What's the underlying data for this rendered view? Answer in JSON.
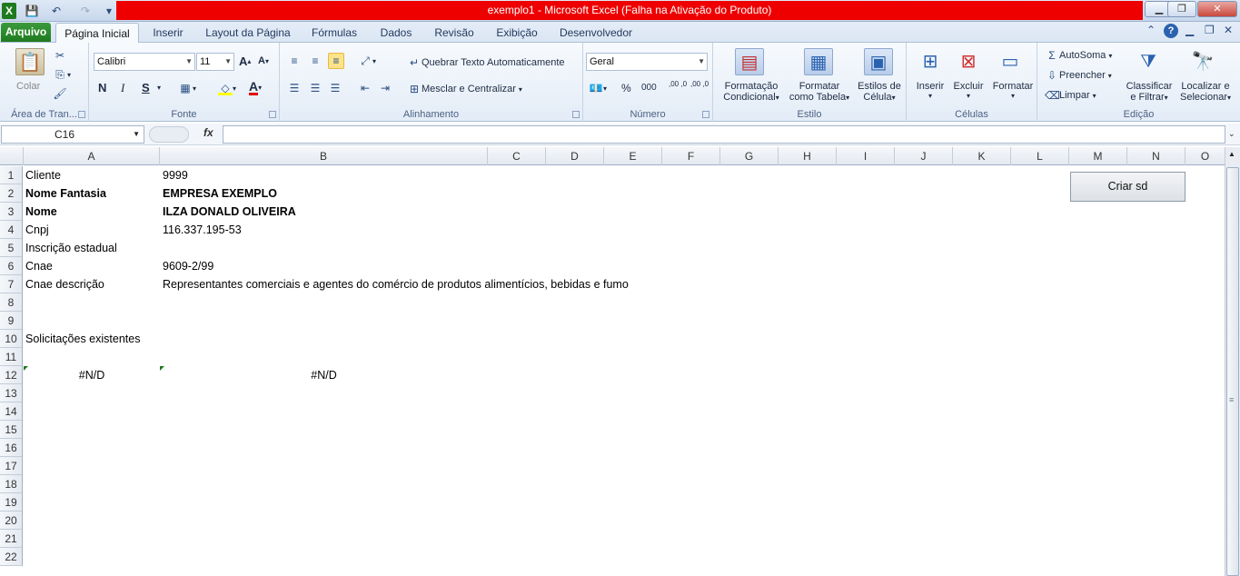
{
  "window": {
    "title": "exemplo1  -  Microsoft Excel (Falha na Ativação do Produto)",
    "minimize": "▁",
    "restore": "❐",
    "close": "✕"
  },
  "qat": {
    "app_icon": "X",
    "save": "💾",
    "undo": "↶",
    "redo": "↷",
    "customize": "▾"
  },
  "tabs": [
    "Arquivo",
    "Página Inicial",
    "Inserir",
    "Layout da Página",
    "Fórmulas",
    "Dados",
    "Revisão",
    "Exibição",
    "Desenvolvedor"
  ],
  "ribbon": {
    "clipboard": {
      "label": "Área de Tran...",
      "paste": "Colar"
    },
    "font": {
      "label": "Fonte",
      "family": "Calibri",
      "size": "11",
      "bold": "N",
      "italic": "I",
      "underline": "S"
    },
    "alignment": {
      "label": "Alinhamento",
      "wrap": "Quebrar Texto Automaticamente",
      "merge": "Mesclar e Centralizar"
    },
    "number": {
      "label": "Número",
      "format": "Geral",
      "percent": "%",
      "thousands": "000",
      "inc_dec": ",00 ,0",
      "dec_dec": ",00 ,0"
    },
    "styles": {
      "label": "Estilo",
      "conditional": [
        "Formatação",
        "Condicional"
      ],
      "table": [
        "Formatar",
        "como Tabela"
      ],
      "cell": [
        "Estilos de",
        "Célula"
      ]
    },
    "cells": {
      "label": "Células",
      "insert": "Inserir",
      "delete": "Excluir",
      "format": "Formatar"
    },
    "editing": {
      "label": "Edição",
      "autosum": "AutoSoma",
      "fill": "Preencher",
      "clear": "Limpar",
      "sort": [
        "Classificar",
        "e Filtrar"
      ],
      "find": [
        "Localizar e",
        "Selecionar"
      ]
    }
  },
  "formula_bar": {
    "name_box": "C16",
    "fx": "fx",
    "value": ""
  },
  "columns": [
    "A",
    "B",
    "C",
    "D",
    "E",
    "F",
    "G",
    "H",
    "I",
    "J",
    "K",
    "L",
    "M",
    "N",
    "O"
  ],
  "rows": [
    "1",
    "2",
    "3",
    "4",
    "5",
    "6",
    "7",
    "8",
    "9",
    "10",
    "11",
    "12",
    "13",
    "14",
    "15",
    "16",
    "17",
    "18",
    "19",
    "20",
    "21",
    "22"
  ],
  "cells": {
    "A1": "Cliente",
    "B1": "9999",
    "A2": "Nome Fantasia",
    "B2": "EMPRESA EXEMPLO",
    "A3": "Nome",
    "B3": "ILZA DONALD OLIVEIRA",
    "A4": "Cnpj",
    "B4": "116.337.195-53",
    "A5": "Inscrição estadual",
    "A6": "Cnae",
    "B6": "9609-2/99",
    "A7": "Cnae descrição",
    "B7": "Representantes comerciais e agentes do comércio de produtos alimentícios, bebidas e fumo",
    "A10": "Solicitações existentes",
    "A12": "#N/D",
    "B12": "#N/D"
  },
  "sheet_button": "Criar sd"
}
